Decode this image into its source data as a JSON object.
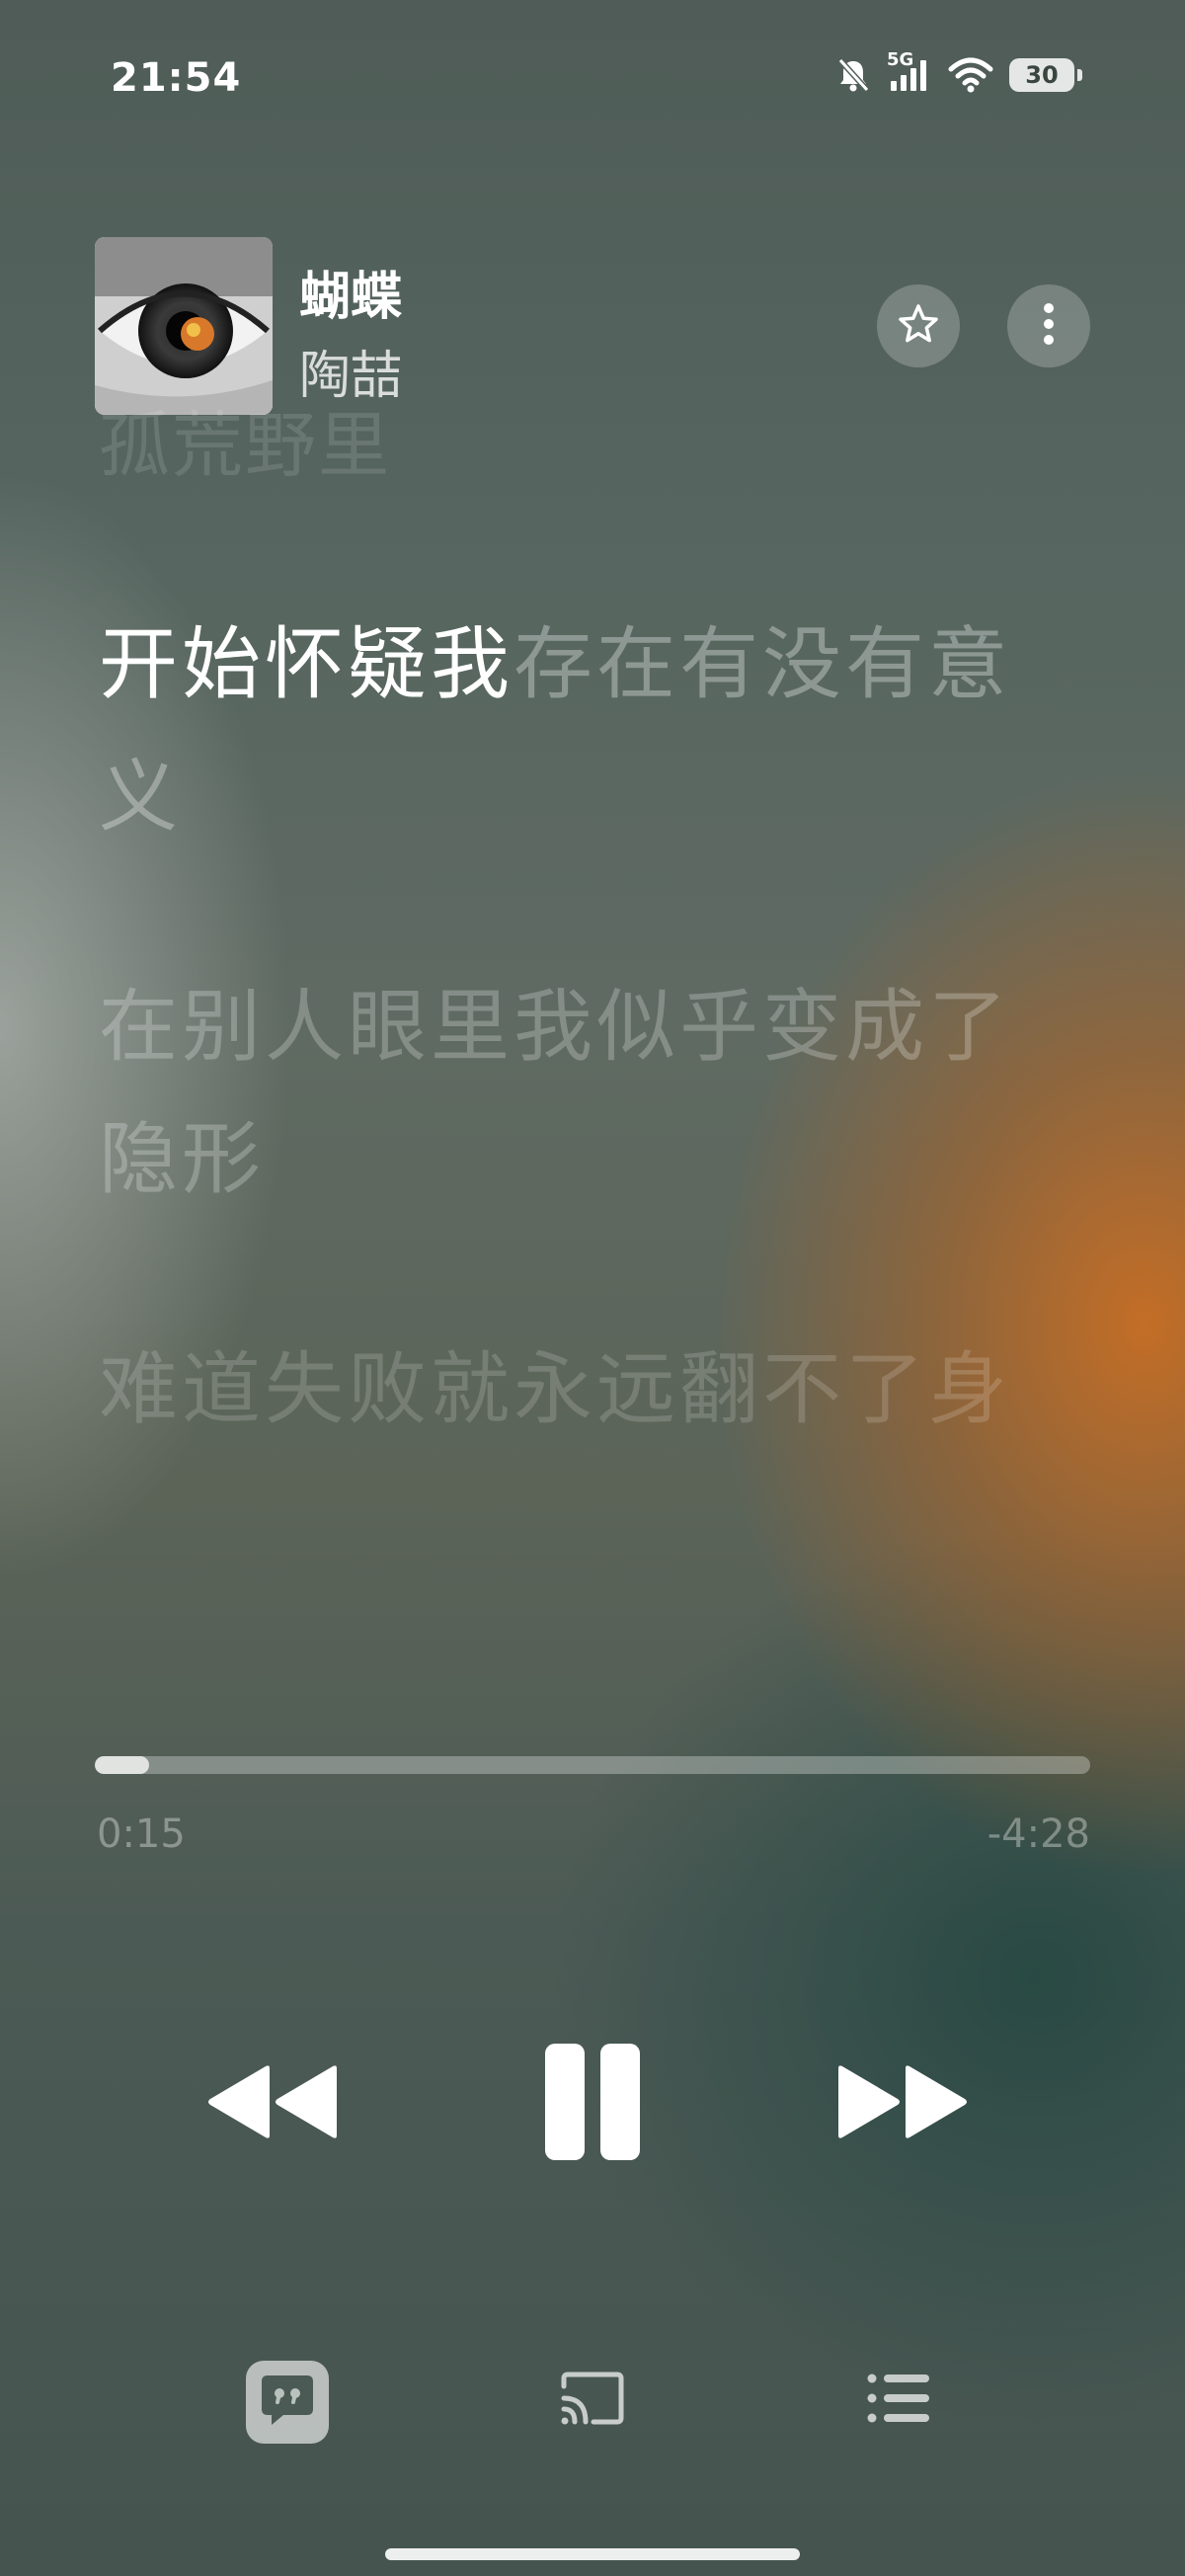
{
  "status_bar": {
    "time": "21:54",
    "network": "5G",
    "battery": "30"
  },
  "now_playing": {
    "title": "蝴蝶",
    "artist": "陶喆",
    "favorite_icon": "star-icon",
    "more_icon": "more-vertical-icon"
  },
  "lyrics": {
    "previous_line": "孤荒野里",
    "current_line_sung": "开始怀疑我",
    "current_line_unsung": "存在有没有意义",
    "next_line": "在别人眼里我似乎变成了隐形",
    "after_line": "难道失败就永远翻不了身"
  },
  "progress": {
    "elapsed": "0:15",
    "remaining": "-4:28",
    "fraction": 0.055
  },
  "controls": {
    "rewind_icon": "rewind-icon",
    "pause_icon": "pause-icon",
    "forward_icon": "fast-forward-icon"
  },
  "bottom_bar": {
    "lyrics_icon": "lyrics-quote-icon",
    "cast_icon": "cast-icon",
    "queue_icon": "queue-list-icon"
  },
  "colors": {
    "accent_orange": "#c96e23",
    "background_dark": "#45544f"
  }
}
